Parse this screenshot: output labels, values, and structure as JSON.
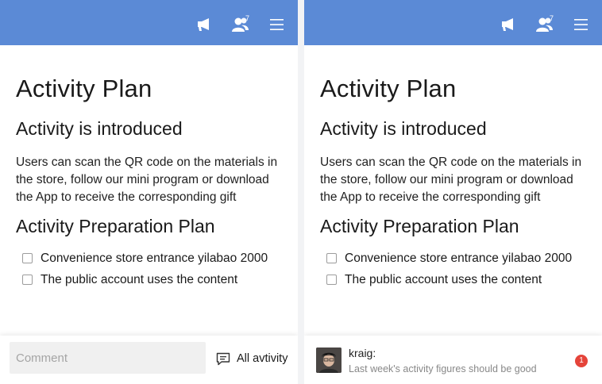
{
  "header": {
    "icons": [
      "announcement-icon",
      "people-icon",
      "menu-icon"
    ],
    "people_count": "7",
    "color": "#5b8ad6"
  },
  "document": {
    "title": "Activity Plan",
    "intro_heading": "Activity is introduced",
    "intro_text": "Users can scan the QR code on the materials in the store, follow our mini program or download the App to receive the corresponding gift",
    "prep_heading": "Activity Preparation Plan",
    "checklist": [
      {
        "text": "Convenience store entrance yilabao 2000",
        "checked": false
      },
      {
        "text": "The public account uses the content",
        "checked": false
      }
    ]
  },
  "comment_bar": {
    "placeholder": "Comment",
    "activity_label": "All avtivity"
  },
  "notification": {
    "user": "kraig:",
    "message": "Last week's activity figures should be good",
    "badge": "1",
    "badge_color": "#e5443a"
  }
}
